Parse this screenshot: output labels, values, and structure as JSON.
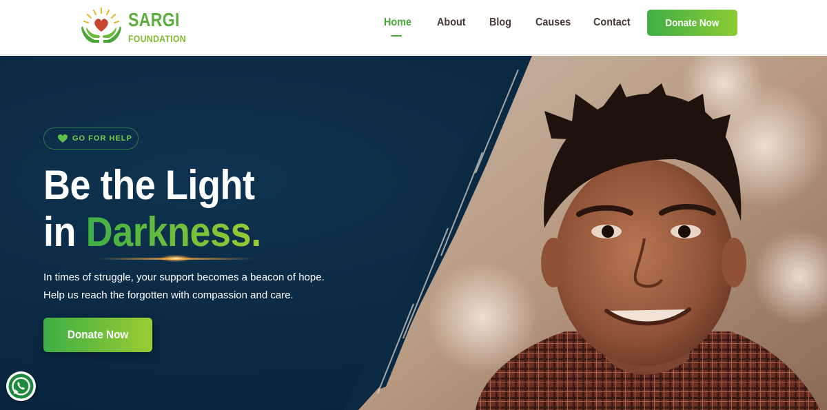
{
  "brand": {
    "name_top": "SARGI",
    "name_bottom": "FOUNDATION",
    "colors": {
      "primary_green": "#4aa83a",
      "lime": "#9acd32",
      "heart": "#c8462e",
      "navy": "#0a2a44"
    },
    "icon": "logo-hands-heart-icon"
  },
  "nav": {
    "items": [
      {
        "label": "Home",
        "active": true
      },
      {
        "label": "About",
        "active": false
      },
      {
        "label": "Blog",
        "active": false
      },
      {
        "label": "Causes",
        "active": false
      },
      {
        "label": "Contact",
        "active": false
      }
    ],
    "cta_label": "Donate Now"
  },
  "hero": {
    "badge": {
      "icon": "heart-icon",
      "label": "GO FOR HELP"
    },
    "headline_line1": "Be the Light",
    "headline_line2_prefix": "in ",
    "headline_line2_accent": "Darkness.",
    "subtext_line1": "In times of struggle, your support becomes a beacon of hope.",
    "subtext_line2": "Help us reach the forgotten with compassion and care.",
    "cta_label": "Donate Now"
  },
  "floating": {
    "whatsapp_icon": "whatsapp-icon"
  }
}
